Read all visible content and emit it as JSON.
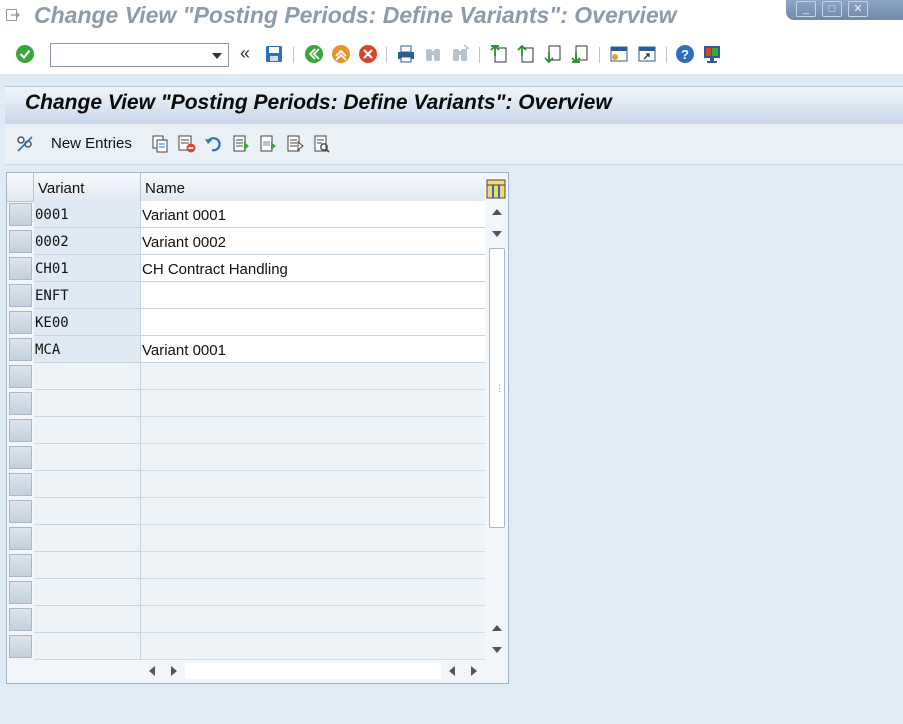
{
  "window": {
    "title": "Change View \"Posting Periods: Define Variants\": Overview",
    "controls": [
      "minimize-icon",
      "maximize-icon",
      "close-icon"
    ]
  },
  "toolbar": {
    "command_field": {
      "value": "",
      "placeholder": ""
    },
    "back_chevron": "«",
    "icons": [
      "enter-check-icon",
      "save-icon",
      "back-icon",
      "exit-icon",
      "cancel-icon",
      "print-icon",
      "find-icon",
      "find-next-icon",
      "first-page-icon",
      "previous-page-icon",
      "next-page-icon",
      "last-page-icon",
      "create-session-icon",
      "shortcut-icon",
      "help-icon",
      "customize-layout-icon"
    ]
  },
  "page": {
    "title": "Change View \"Posting Periods: Define Variants\": Overview"
  },
  "app_toolbar": {
    "new_entries_label": "New Entries",
    "icons": [
      "display-change-icon",
      "copy-as-icon",
      "delete-icon",
      "undo-change-icon",
      "select-all-icon",
      "select-block-icon",
      "deselect-all-icon",
      "print-preview-icon"
    ]
  },
  "table": {
    "columns": [
      "Variant",
      "Name"
    ],
    "rows": [
      {
        "variant": "0001",
        "name": "Variant 0001"
      },
      {
        "variant": "0002",
        "name": "Variant 0002"
      },
      {
        "variant": "CH01",
        "name": "CH Contract Handling"
      },
      {
        "variant": "ENFT",
        "name": ""
      },
      {
        "variant": "KE00",
        "name": ""
      },
      {
        "variant": "MCA",
        "name": "Variant 0001"
      }
    ],
    "empty_row_count": 11
  },
  "colors": {
    "background": "#dfebf5",
    "title_grey": "#8d9bab",
    "key_cell": "#dfeaf5",
    "check_green": "#3aa53a",
    "exit_orange": "#e8922a",
    "cancel_red": "#d7452f",
    "help_blue": "#2e6fbf"
  }
}
